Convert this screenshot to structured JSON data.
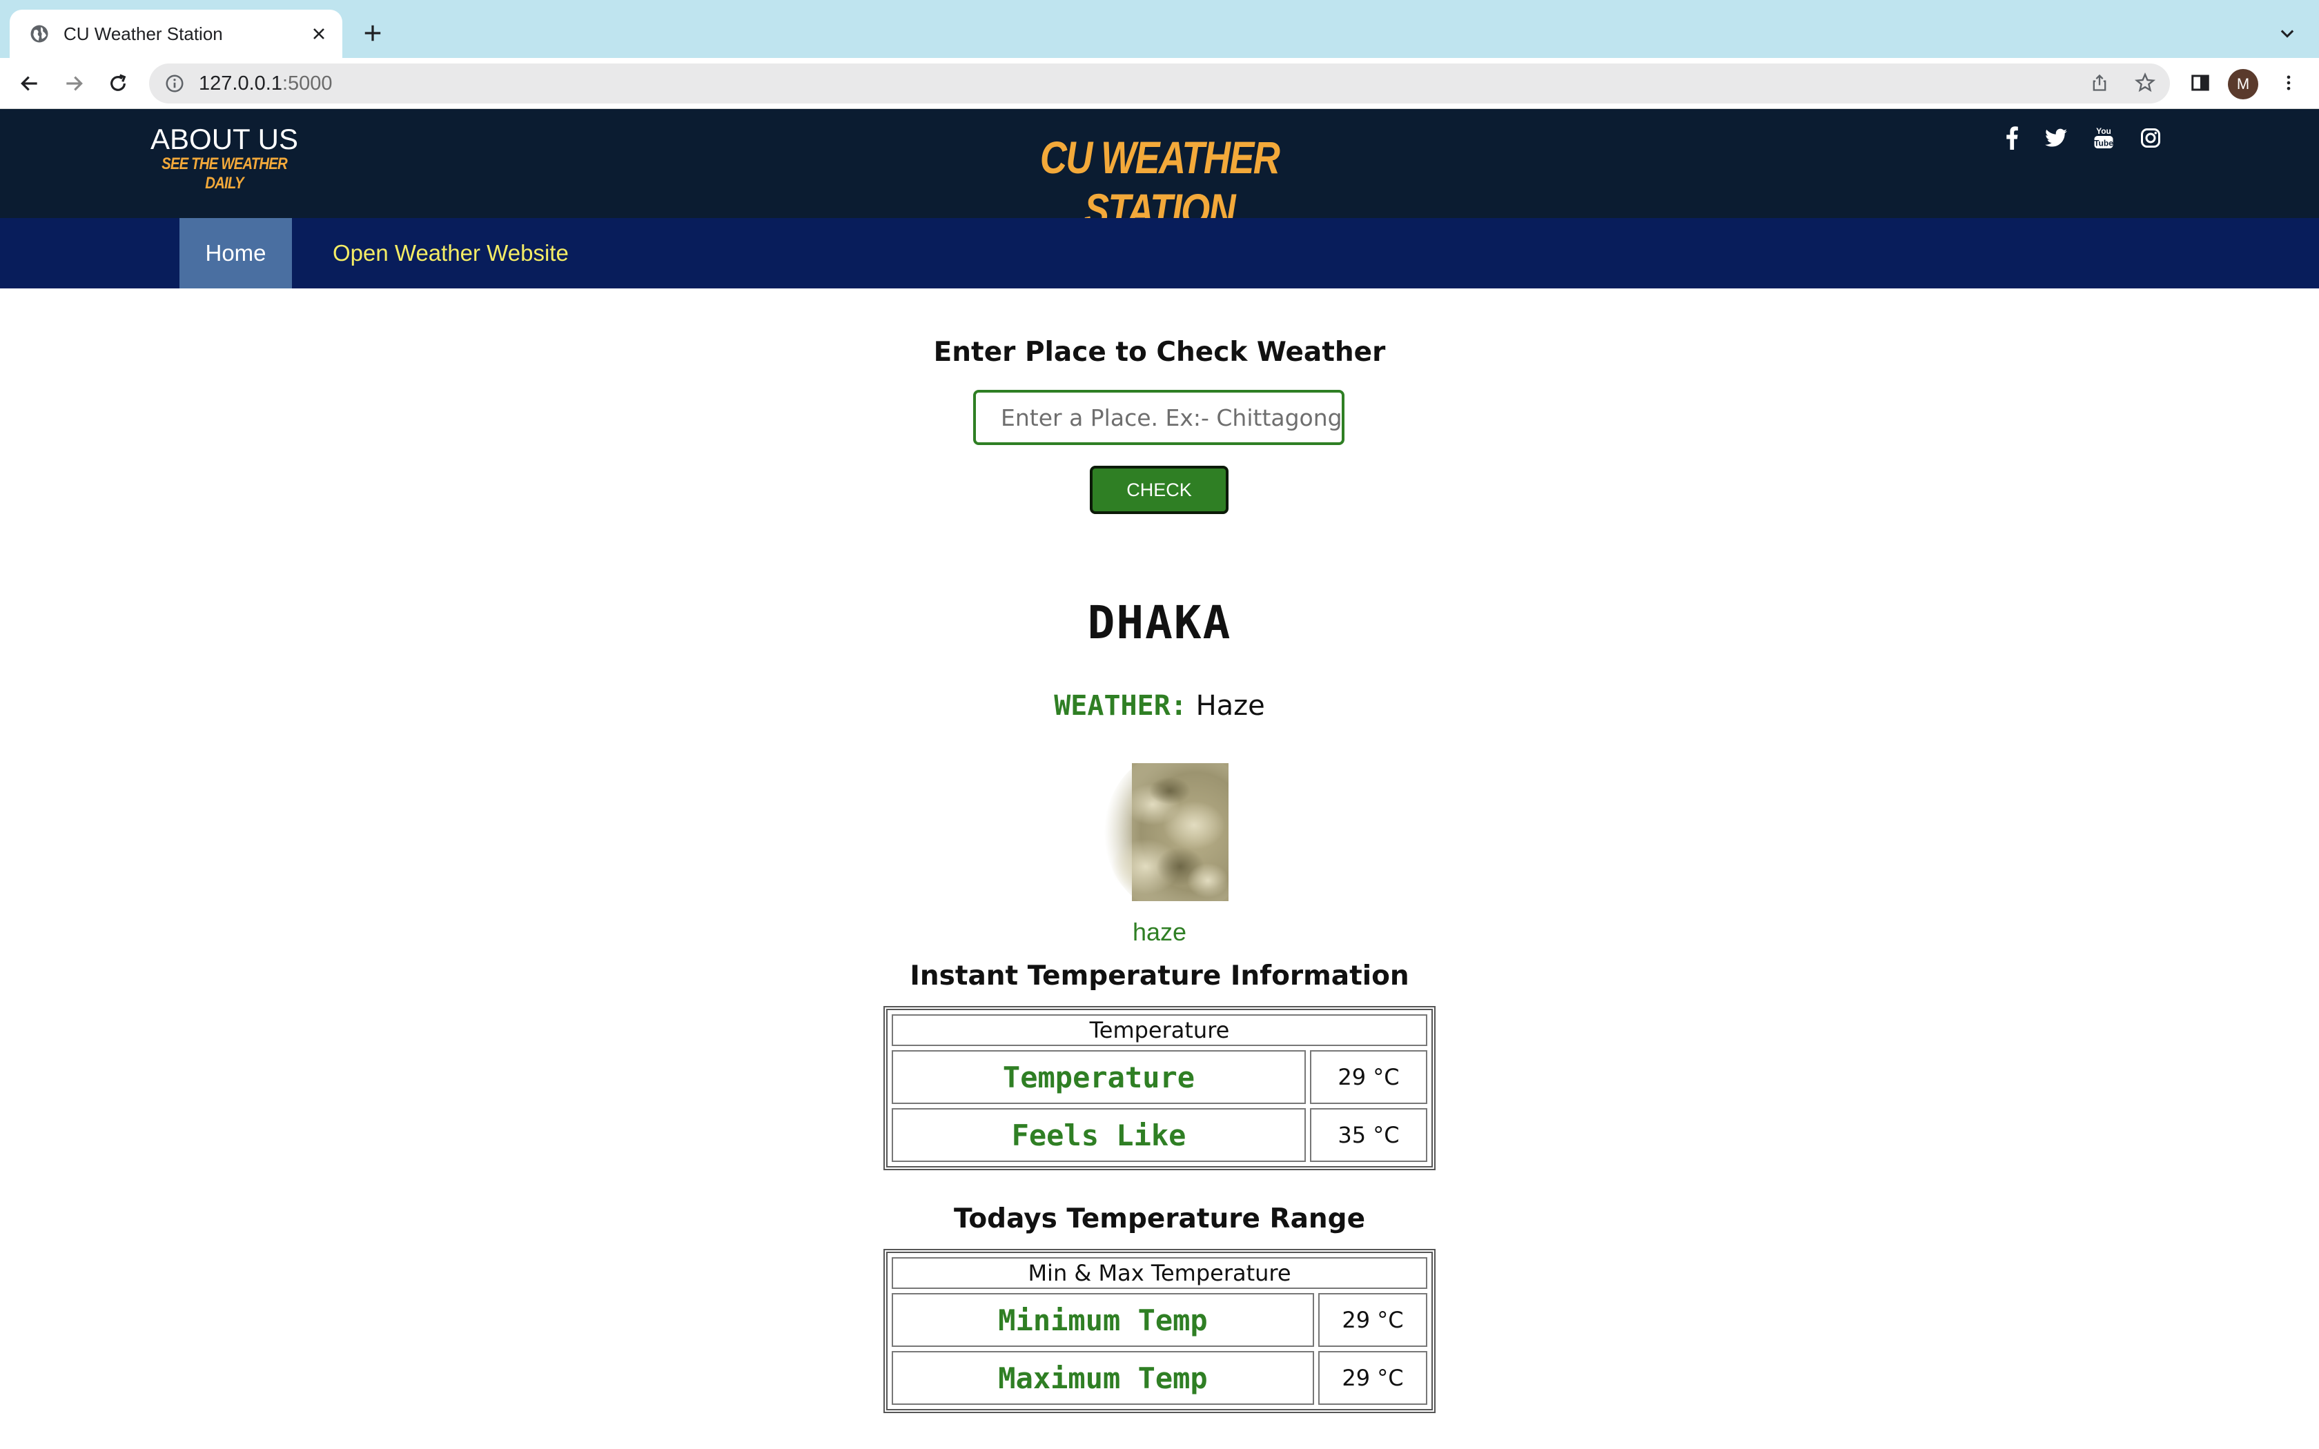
{
  "browser": {
    "tab_title": "CU Weather Station",
    "url_host": "127.0.0.1",
    "url_port": ":5000",
    "avatar_letter": "M"
  },
  "header": {
    "about_title": "ABOUT US",
    "about_subtitle": "SEE THE WEATHER DAILY",
    "brand": "CU WEATHER STATION",
    "social_icons": [
      "facebook-icon",
      "twitter-icon",
      "youtube-icon",
      "instagram-icon"
    ]
  },
  "nav": {
    "home": "Home",
    "open_weather": "Open Weather Website"
  },
  "search": {
    "heading": "Enter Place to Check Weather",
    "placeholder": "Enter a Place. Ex:- Chittagong",
    "value": "",
    "button": "CHECK"
  },
  "result": {
    "city": "DHAKA",
    "weather_label": "WEATHER:",
    "weather_value": "Haze",
    "icon_caption": "haze"
  },
  "instant": {
    "title": "Instant Temperature Information",
    "caption": "Temperature",
    "rows": [
      {
        "label": "Temperature",
        "value": "29 °C"
      },
      {
        "label": "Feels Like",
        "value": "35 °C"
      }
    ]
  },
  "range": {
    "title": "Todays Temperature Range",
    "caption": "Min & Max Temperature",
    "rows": [
      {
        "label": "Minimum Temp",
        "value": "29 °C"
      },
      {
        "label": "Maximum Temp",
        "value": "29 °C"
      }
    ]
  },
  "colors": {
    "header_bg": "#0b1c31",
    "nav_bg": "#081d5b",
    "nav_active_bg": "#4a6fa1",
    "brand_orange": "#f3a93a",
    "nav_link_yellow": "#f4ec65",
    "accent_green": "#2f7f24",
    "tabstrip_bg": "#bfe4ef"
  }
}
